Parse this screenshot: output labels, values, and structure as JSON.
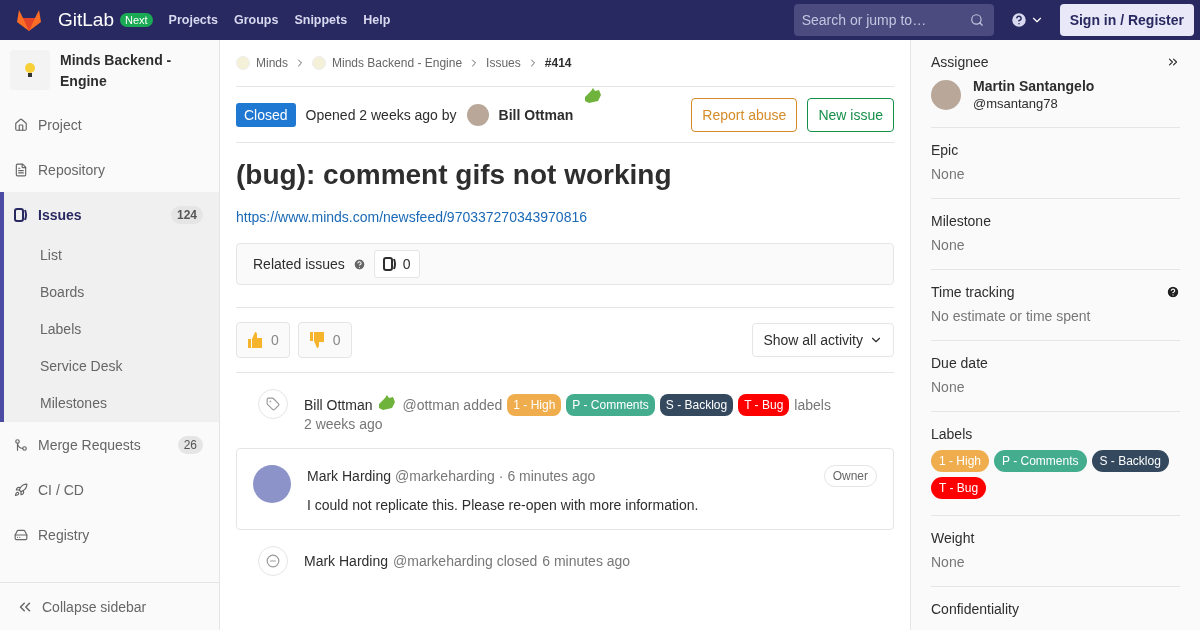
{
  "topbar": {
    "brand": "GitLab",
    "badge": "Next",
    "links": [
      "Projects",
      "Groups",
      "Snippets",
      "Help"
    ],
    "search": {
      "placeholder": "Search or jump to…"
    },
    "sign_in": "Sign in / Register"
  },
  "sidebar": {
    "project": "Minds Backend - Engine",
    "items": [
      {
        "kind": "home",
        "label": "Project",
        "selected": false
      },
      {
        "kind": "file",
        "label": "Repository",
        "selected": false
      },
      {
        "kind": "issues",
        "label": "Issues",
        "count": "124",
        "selected": true,
        "children": [
          {
            "label": "List"
          },
          {
            "label": "Boards"
          },
          {
            "label": "Labels"
          },
          {
            "label": "Service Desk"
          },
          {
            "label": "Milestones"
          }
        ]
      },
      {
        "kind": "merge",
        "label": "Merge Requests",
        "count": "26",
        "selected": false
      },
      {
        "kind": "rocket",
        "label": "CI / CD",
        "selected": false
      },
      {
        "kind": "registry",
        "label": "Registry",
        "selected": false
      }
    ],
    "collapse": "Collapse sidebar"
  },
  "breadcrumbs": [
    "Minds",
    "Minds Backend - Engine",
    "Issues",
    "#414"
  ],
  "issue": {
    "status": "Closed",
    "opened": "Opened 2 weeks ago by",
    "author": "Bill Ottman",
    "buttons": [
      "Report abuse",
      "New issue"
    ],
    "title": "(bug): comment gifs not working",
    "link": "https://www.minds.com/newsfeed/970337270343970816",
    "related": {
      "label": "Related issues",
      "count": "0"
    },
    "reactions": [
      {
        "kind": "up",
        "count": "0"
      },
      {
        "kind": "down",
        "count": "0"
      }
    ],
    "activity_filter": "Show all activity"
  },
  "timeline": [
    {
      "kind": "label_event",
      "author": "Bill Ottman",
      "text": "@ottman added",
      "labels": [
        {
          "name": "1 - High",
          "color": "#f0ad4e"
        },
        {
          "name": "P - Comments",
          "color": "#44ad8e"
        },
        {
          "name": "S - Backlog",
          "color": "#34495e"
        },
        {
          "name": "T - Bug",
          "color": "#ff0000"
        }
      ],
      "after": "labels",
      "time": "2 weeks ago"
    },
    {
      "kind": "comment",
      "author": "Mark Harding",
      "handle": "@markeharding",
      "time": "· 6 minutes ago",
      "role": "Owner",
      "body": "I could not replicate this. Please re-open with more information."
    },
    {
      "kind": "close_event",
      "author": "Mark Harding",
      "text": "@markeharding closed",
      "time": "6 minutes ago"
    }
  ],
  "right": {
    "assignee": {
      "title": "Assignee",
      "name": "Martin Santangelo",
      "handle": "@msantang78"
    },
    "sections": [
      {
        "title": "Epic",
        "value": "None"
      },
      {
        "title": "Milestone",
        "value": "None"
      },
      {
        "title": "Time tracking",
        "value": "No estimate or time spent",
        "help": true
      },
      {
        "title": "Due date",
        "value": "None"
      },
      {
        "title": "Labels",
        "labels": [
          {
            "name": "1 - High",
            "color": "#f0ad4e"
          },
          {
            "name": "P - Comments",
            "color": "#44ad8e"
          },
          {
            "name": "S - Backlog",
            "color": "#34495e"
          },
          {
            "name": "T - Bug",
            "color": "#ff0000"
          }
        ]
      },
      {
        "title": "Weight",
        "value": "None"
      },
      {
        "title": "Confidentiality"
      }
    ]
  }
}
